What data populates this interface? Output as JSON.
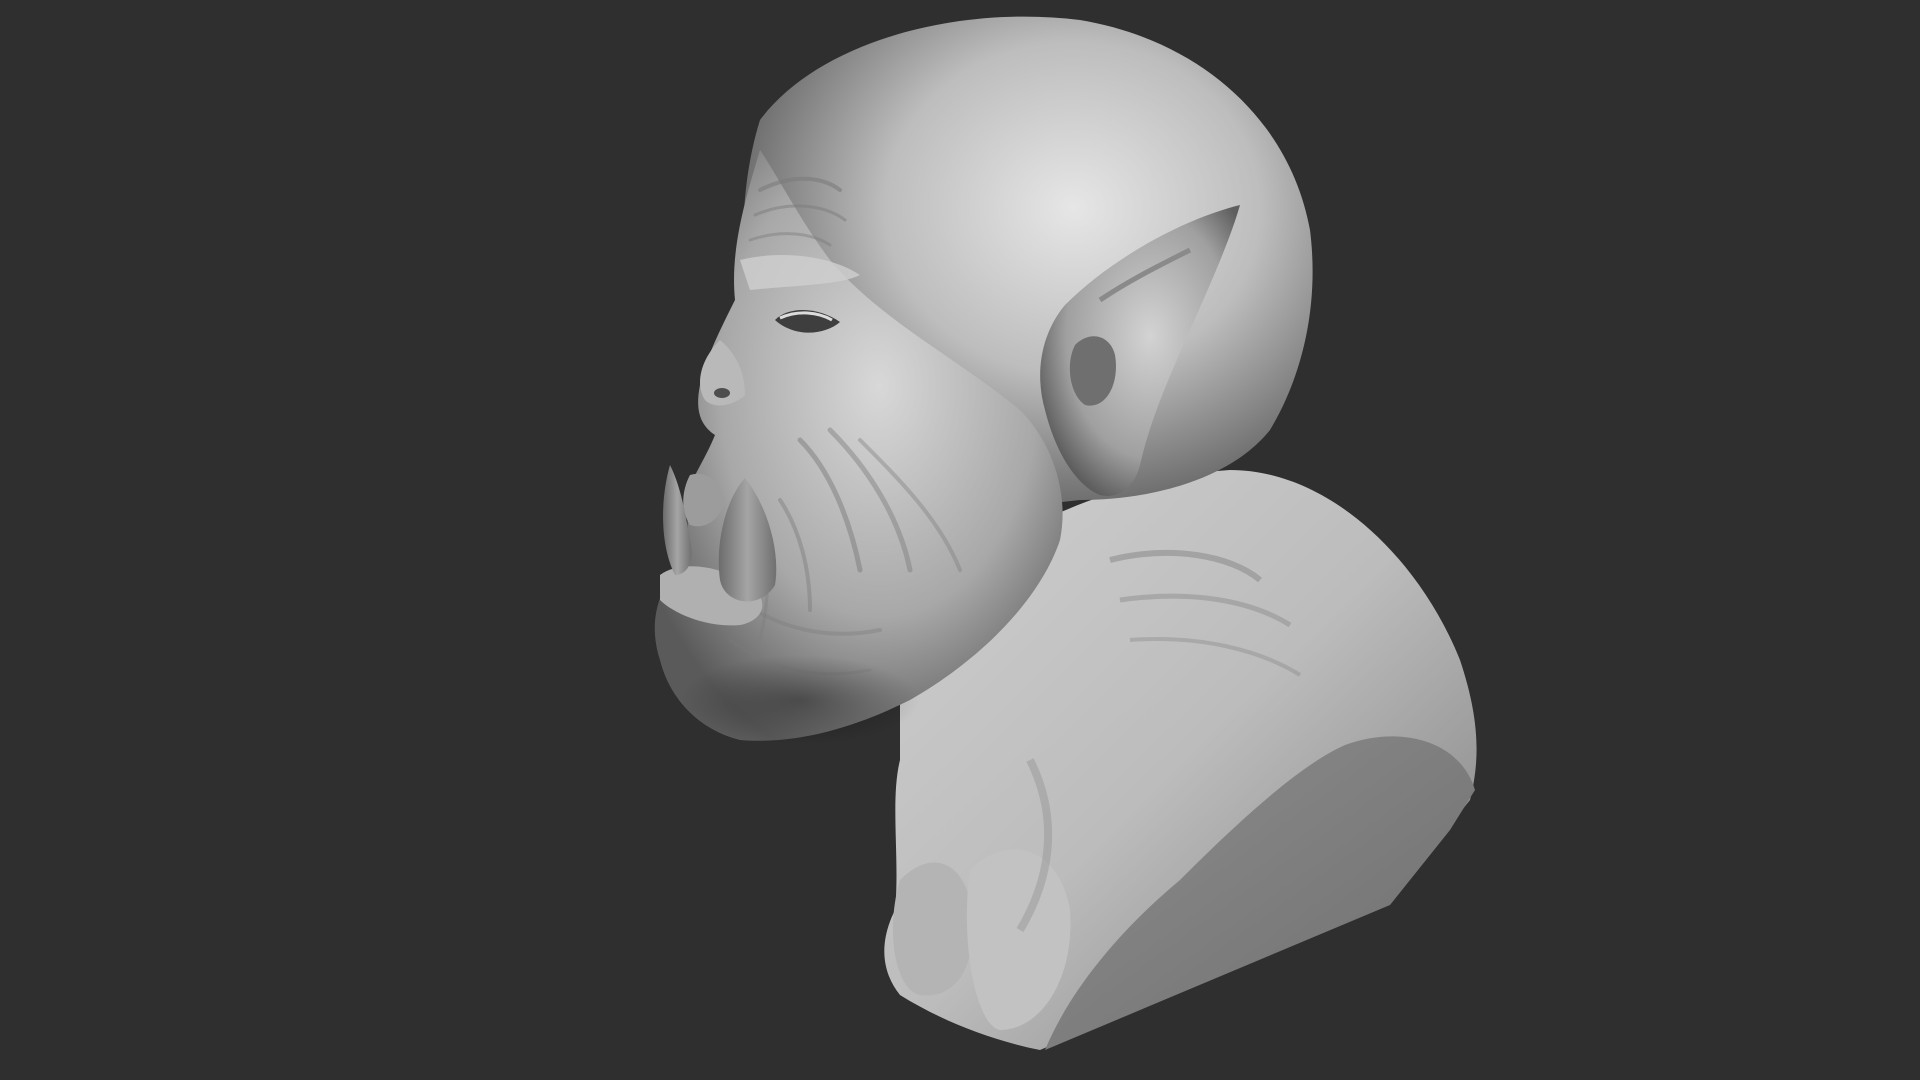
{
  "viewport": {
    "background_color": "#2f2f2f",
    "model": {
      "subject": "orc-bust-sculpt",
      "material_base": "#9a9a9a",
      "material_highlight": "#e2e2e2",
      "material_shadow": "#4a4a4a",
      "view": "left-profile"
    }
  }
}
